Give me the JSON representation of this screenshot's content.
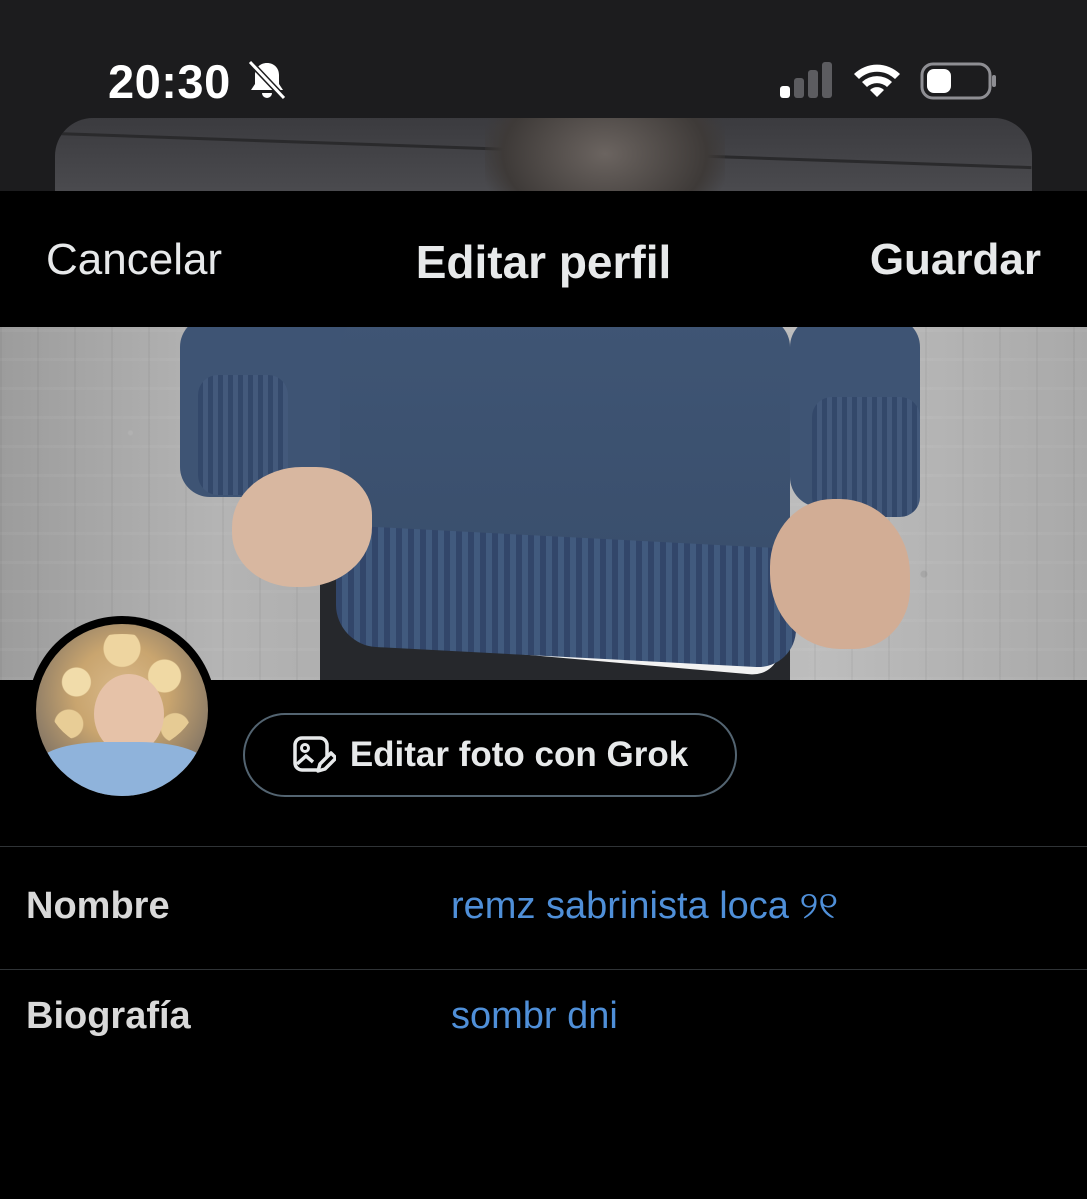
{
  "status_bar": {
    "time": "20:30",
    "icons": [
      "bell-slash-icon",
      "cellular-signal-icon",
      "wifi-icon",
      "battery-icon"
    ]
  },
  "header": {
    "cancel_label": "Cancelar",
    "title": "Editar perfil",
    "save_label": "Guardar"
  },
  "profile": {
    "grok_button_label": "Editar foto con Grok",
    "grok_icon": "photo-edit-icon"
  },
  "fields": [
    {
      "label": "Nombre",
      "value": "remz sabrinista loca ୨୧"
    },
    {
      "label": "Biografía",
      "value": "sombr dni"
    }
  ],
  "colors": {
    "background": "#000000",
    "link_blue": "#4f8fd8",
    "divider": "#2f3336",
    "text": "#e7e9ea"
  }
}
